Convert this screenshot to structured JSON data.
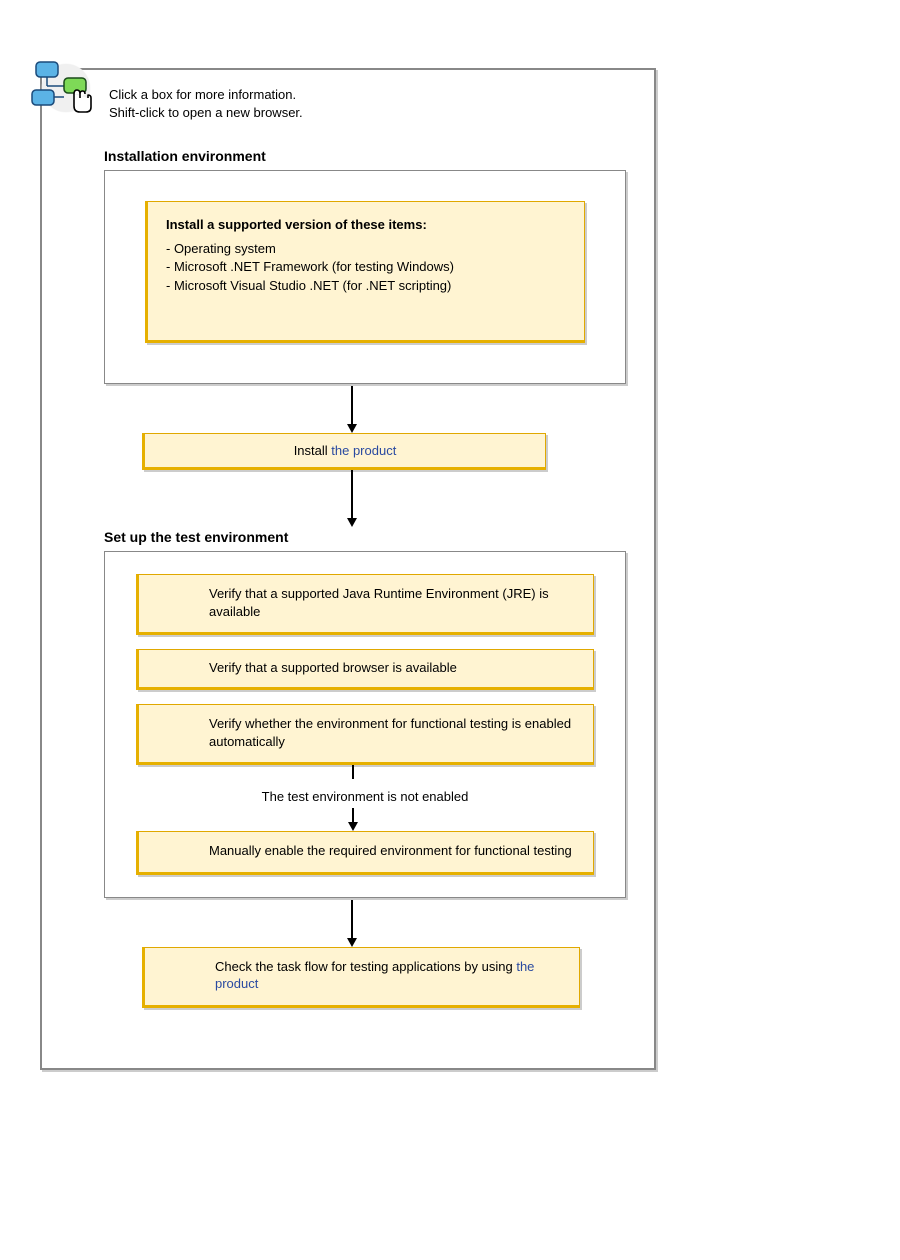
{
  "header": {
    "line1": "Click a box for more information.",
    "line2": "Shift-click to open a new browser."
  },
  "sections": {
    "install_env": {
      "title": "Installation environment",
      "supported_box": {
        "heading": "Install a supported version of these items:",
        "items": [
          "- Operating system",
          "- Microsoft .NET Framework (for testing Windows)",
          "- Microsoft Visual Studio .NET (for .NET scripting)"
        ]
      }
    },
    "install_product": {
      "prefix": "Install ",
      "link": "the product"
    },
    "test_env": {
      "title": "Set up the test environment",
      "steps": {
        "jre": "Verify that a supported Java Runtime Environment (JRE) is available",
        "browser": "Verify that a supported browser is available",
        "auto_enable": "Verify whether the environment for functional testing is enabled automatically",
        "branch_label": "The test environment is not enabled",
        "manual_enable": "Manually enable the required environment for functional testing"
      }
    },
    "task_flow": {
      "prefix": "Check the task flow for testing applications by using ",
      "link": "the product"
    }
  }
}
